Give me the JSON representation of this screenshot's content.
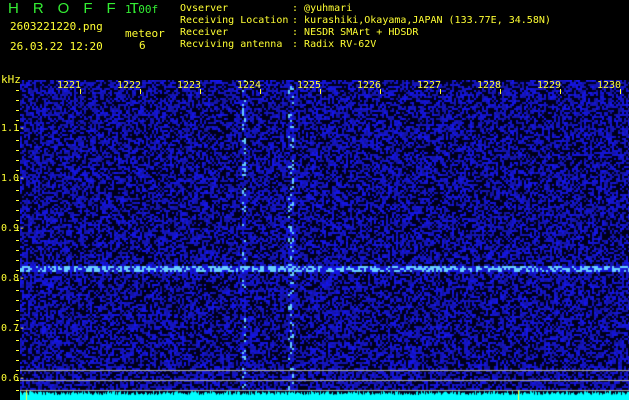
{
  "header": {
    "logo": "HROFFT",
    "version": "1.00f",
    "filename": "2603221220.png",
    "datetime": "26.03.22 12:20",
    "meteor_label": "meteor",
    "meteor_count": "6"
  },
  "info": [
    {
      "label": "Ovserver",
      "value": "@yuhmari"
    },
    {
      "label": "Receiving Location",
      "value": "kurashiki,Okayama,JAPAN (133.77E, 34.58N)"
    },
    {
      "label": "Receiver",
      "value": "NESDR SMArt + HDSDR"
    },
    {
      "label": "Recviving antenna",
      "value": "Radix RV-62V"
    }
  ],
  "axis": {
    "unit": "kHz",
    "x_ticks": [
      "1221",
      "1222",
      "1223",
      "1224",
      "1225",
      "1226",
      "1227",
      "1228",
      "1229",
      "1230"
    ],
    "y_ticks": [
      "1.1",
      "1.0",
      "0.9",
      "0.8",
      "0.7",
      "0.6"
    ]
  },
  "colors": {
    "noise": "#1a1aff",
    "trace": "#66aaff",
    "bar": "#00ffff"
  }
}
